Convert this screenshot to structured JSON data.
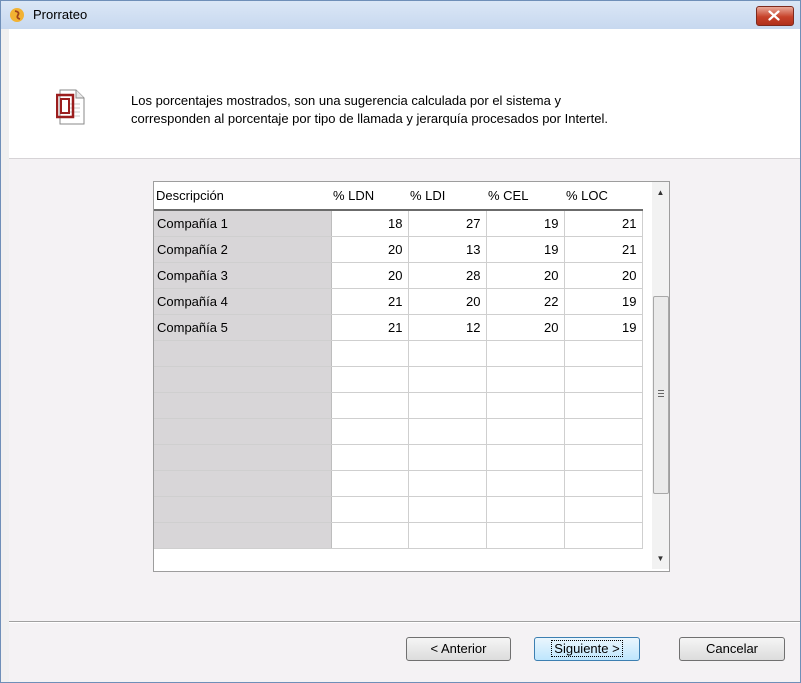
{
  "window": {
    "title": "Prorrateo"
  },
  "header": {
    "line1": "Los porcentajes mostrados, son una sugerencia calculada por el sistema y",
    "line2": "corresponden al porcentaje por tipo de llamada y jerarquía  procesados por Intertel."
  },
  "grid": {
    "columns": [
      "Descripción",
      "% LDN",
      "% LDI",
      "% CEL",
      "% LOC"
    ],
    "rows": [
      [
        "Compañía 1",
        "18",
        "27",
        "19",
        "21"
      ],
      [
        "Compañía 2",
        "20",
        "13",
        "19",
        "21"
      ],
      [
        "Compañía 3",
        "20",
        "28",
        "20",
        "20"
      ],
      [
        "Compañía 4",
        "21",
        "20",
        "22",
        "19"
      ],
      [
        "Compañía 5",
        "21",
        "12",
        "20",
        "19"
      ]
    ],
    "empty_rows": 8
  },
  "buttons": {
    "back": "< Anterior",
    "next": "Siguiente >",
    "cancel": "Cancelar"
  }
}
